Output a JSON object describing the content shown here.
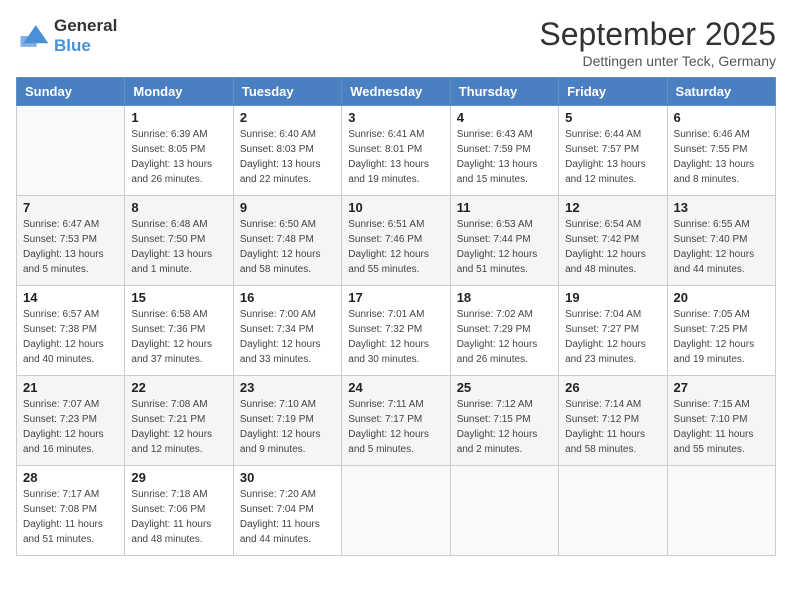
{
  "header": {
    "logo_general": "General",
    "logo_blue": "Blue",
    "title": "September 2025",
    "location": "Dettingen unter Teck, Germany"
  },
  "weekdays": [
    "Sunday",
    "Monday",
    "Tuesday",
    "Wednesday",
    "Thursday",
    "Friday",
    "Saturday"
  ],
  "weeks": [
    [
      {
        "day": "",
        "sunrise": "",
        "sunset": "",
        "daylight": ""
      },
      {
        "day": "1",
        "sunrise": "Sunrise: 6:39 AM",
        "sunset": "Sunset: 8:05 PM",
        "daylight": "Daylight: 13 hours and 26 minutes."
      },
      {
        "day": "2",
        "sunrise": "Sunrise: 6:40 AM",
        "sunset": "Sunset: 8:03 PM",
        "daylight": "Daylight: 13 hours and 22 minutes."
      },
      {
        "day": "3",
        "sunrise": "Sunrise: 6:41 AM",
        "sunset": "Sunset: 8:01 PM",
        "daylight": "Daylight: 13 hours and 19 minutes."
      },
      {
        "day": "4",
        "sunrise": "Sunrise: 6:43 AM",
        "sunset": "Sunset: 7:59 PM",
        "daylight": "Daylight: 13 hours and 15 minutes."
      },
      {
        "day": "5",
        "sunrise": "Sunrise: 6:44 AM",
        "sunset": "Sunset: 7:57 PM",
        "daylight": "Daylight: 13 hours and 12 minutes."
      },
      {
        "day": "6",
        "sunrise": "Sunrise: 6:46 AM",
        "sunset": "Sunset: 7:55 PM",
        "daylight": "Daylight: 13 hours and 8 minutes."
      }
    ],
    [
      {
        "day": "7",
        "sunrise": "Sunrise: 6:47 AM",
        "sunset": "Sunset: 7:53 PM",
        "daylight": "Daylight: 13 hours and 5 minutes."
      },
      {
        "day": "8",
        "sunrise": "Sunrise: 6:48 AM",
        "sunset": "Sunset: 7:50 PM",
        "daylight": "Daylight: 13 hours and 1 minute."
      },
      {
        "day": "9",
        "sunrise": "Sunrise: 6:50 AM",
        "sunset": "Sunset: 7:48 PM",
        "daylight": "Daylight: 12 hours and 58 minutes."
      },
      {
        "day": "10",
        "sunrise": "Sunrise: 6:51 AM",
        "sunset": "Sunset: 7:46 PM",
        "daylight": "Daylight: 12 hours and 55 minutes."
      },
      {
        "day": "11",
        "sunrise": "Sunrise: 6:53 AM",
        "sunset": "Sunset: 7:44 PM",
        "daylight": "Daylight: 12 hours and 51 minutes."
      },
      {
        "day": "12",
        "sunrise": "Sunrise: 6:54 AM",
        "sunset": "Sunset: 7:42 PM",
        "daylight": "Daylight: 12 hours and 48 minutes."
      },
      {
        "day": "13",
        "sunrise": "Sunrise: 6:55 AM",
        "sunset": "Sunset: 7:40 PM",
        "daylight": "Daylight: 12 hours and 44 minutes."
      }
    ],
    [
      {
        "day": "14",
        "sunrise": "Sunrise: 6:57 AM",
        "sunset": "Sunset: 7:38 PM",
        "daylight": "Daylight: 12 hours and 40 minutes."
      },
      {
        "day": "15",
        "sunrise": "Sunrise: 6:58 AM",
        "sunset": "Sunset: 7:36 PM",
        "daylight": "Daylight: 12 hours and 37 minutes."
      },
      {
        "day": "16",
        "sunrise": "Sunrise: 7:00 AM",
        "sunset": "Sunset: 7:34 PM",
        "daylight": "Daylight: 12 hours and 33 minutes."
      },
      {
        "day": "17",
        "sunrise": "Sunrise: 7:01 AM",
        "sunset": "Sunset: 7:32 PM",
        "daylight": "Daylight: 12 hours and 30 minutes."
      },
      {
        "day": "18",
        "sunrise": "Sunrise: 7:02 AM",
        "sunset": "Sunset: 7:29 PM",
        "daylight": "Daylight: 12 hours and 26 minutes."
      },
      {
        "day": "19",
        "sunrise": "Sunrise: 7:04 AM",
        "sunset": "Sunset: 7:27 PM",
        "daylight": "Daylight: 12 hours and 23 minutes."
      },
      {
        "day": "20",
        "sunrise": "Sunrise: 7:05 AM",
        "sunset": "Sunset: 7:25 PM",
        "daylight": "Daylight: 12 hours and 19 minutes."
      }
    ],
    [
      {
        "day": "21",
        "sunrise": "Sunrise: 7:07 AM",
        "sunset": "Sunset: 7:23 PM",
        "daylight": "Daylight: 12 hours and 16 minutes."
      },
      {
        "day": "22",
        "sunrise": "Sunrise: 7:08 AM",
        "sunset": "Sunset: 7:21 PM",
        "daylight": "Daylight: 12 hours and 12 minutes."
      },
      {
        "day": "23",
        "sunrise": "Sunrise: 7:10 AM",
        "sunset": "Sunset: 7:19 PM",
        "daylight": "Daylight: 12 hours and 9 minutes."
      },
      {
        "day": "24",
        "sunrise": "Sunrise: 7:11 AM",
        "sunset": "Sunset: 7:17 PM",
        "daylight": "Daylight: 12 hours and 5 minutes."
      },
      {
        "day": "25",
        "sunrise": "Sunrise: 7:12 AM",
        "sunset": "Sunset: 7:15 PM",
        "daylight": "Daylight: 12 hours and 2 minutes."
      },
      {
        "day": "26",
        "sunrise": "Sunrise: 7:14 AM",
        "sunset": "Sunset: 7:12 PM",
        "daylight": "Daylight: 11 hours and 58 minutes."
      },
      {
        "day": "27",
        "sunrise": "Sunrise: 7:15 AM",
        "sunset": "Sunset: 7:10 PM",
        "daylight": "Daylight: 11 hours and 55 minutes."
      }
    ],
    [
      {
        "day": "28",
        "sunrise": "Sunrise: 7:17 AM",
        "sunset": "Sunset: 7:08 PM",
        "daylight": "Daylight: 11 hours and 51 minutes."
      },
      {
        "day": "29",
        "sunrise": "Sunrise: 7:18 AM",
        "sunset": "Sunset: 7:06 PM",
        "daylight": "Daylight: 11 hours and 48 minutes."
      },
      {
        "day": "30",
        "sunrise": "Sunrise: 7:20 AM",
        "sunset": "Sunset: 7:04 PM",
        "daylight": "Daylight: 11 hours and 44 minutes."
      },
      {
        "day": "",
        "sunrise": "",
        "sunset": "",
        "daylight": ""
      },
      {
        "day": "",
        "sunrise": "",
        "sunset": "",
        "daylight": ""
      },
      {
        "day": "",
        "sunrise": "",
        "sunset": "",
        "daylight": ""
      },
      {
        "day": "",
        "sunrise": "",
        "sunset": "",
        "daylight": ""
      }
    ]
  ]
}
